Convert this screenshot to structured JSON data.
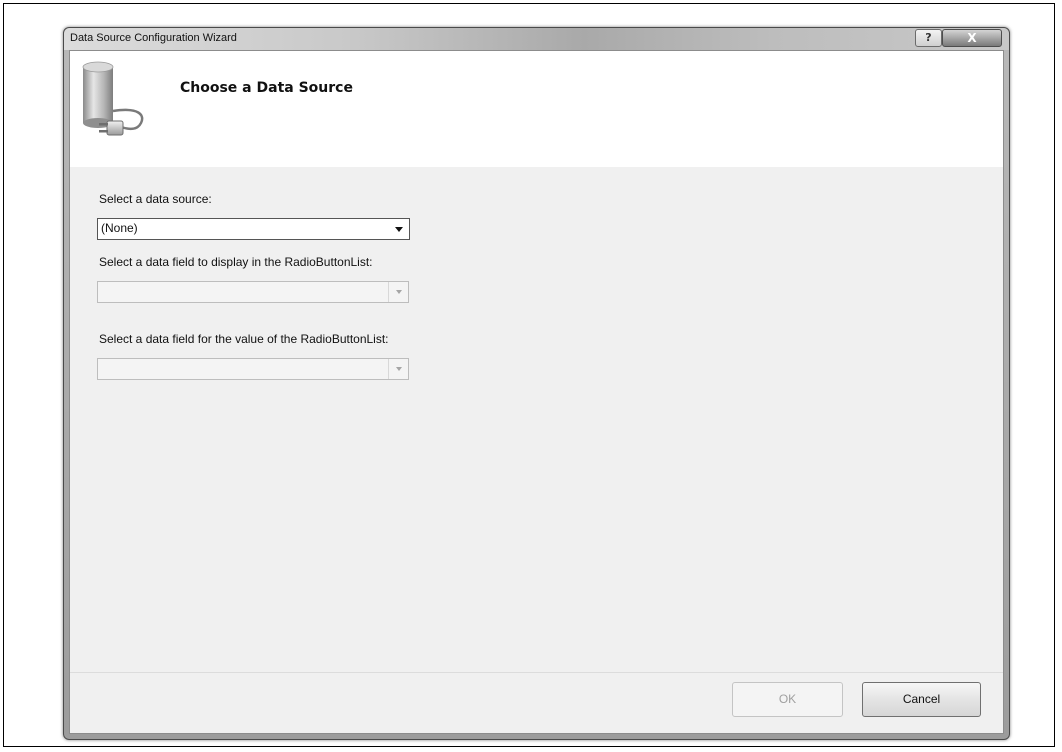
{
  "window": {
    "title": "Data Source Configuration Wizard",
    "help_label": "?",
    "close_label": "X"
  },
  "header": {
    "title": "Choose a Data Source",
    "icon": "database-plug-icon"
  },
  "fields": {
    "data_source": {
      "label": "Select a data source:",
      "value": "(None)"
    },
    "display_field": {
      "label": "Select a data field to display in the RadioButtonList:",
      "value": ""
    },
    "value_field": {
      "label": "Select a data field for the value of the RadioButtonList:",
      "value": ""
    }
  },
  "buttons": {
    "ok_label": "OK",
    "cancel_label": "Cancel"
  }
}
